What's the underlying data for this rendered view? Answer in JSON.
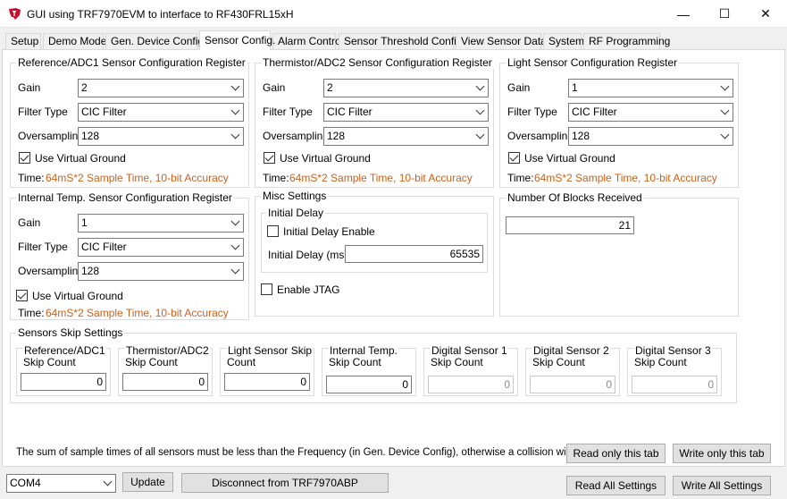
{
  "window": {
    "title": "GUI using TRF7970EVM to interface to RF430FRL15xH",
    "minimize": "—",
    "maximize": "☐",
    "close": "✕"
  },
  "tabs": [
    {
      "label": "Setup"
    },
    {
      "label": "Demo Mode"
    },
    {
      "label": "Gen. Device Config"
    },
    {
      "label": "Sensor Config."
    },
    {
      "label": "Alarm Control"
    },
    {
      "label": "Sensor Threshold Config."
    },
    {
      "label": "View Sensor Data"
    },
    {
      "label": "System"
    },
    {
      "label": "RF Programming"
    }
  ],
  "labels": {
    "gain": "Gain",
    "filter_type": "Filter Type",
    "oversampling": "Oversampling",
    "use_virtual_ground": "Use Virtual Ground",
    "time": "Time:"
  },
  "ref_adc1": {
    "title": "Reference/ADC1 Sensor Configuration Register",
    "gain": "2",
    "filter": "CIC Filter",
    "oversampling": "128",
    "time_value": "64mS*2 Sample Time, 10-bit Accuracy"
  },
  "thermistor": {
    "title": "Thermistor/ADC2 Sensor Configuration Register",
    "gain": "2",
    "filter": "CIC Filter",
    "oversampling": "128",
    "time_value": "64mS*2 Sample Time, 10-bit Accuracy"
  },
  "light": {
    "title": "Light Sensor Configuration Register",
    "gain": "1",
    "filter": "CIC Filter",
    "oversampling": "128",
    "time_value": "64mS*2 Sample Time, 10-bit Accuracy"
  },
  "internal_temp": {
    "title": "Internal Temp. Sensor Configuration Register",
    "gain": "1",
    "filter": "CIC Filter",
    "oversampling": "128",
    "time_value": "64mS*2 Sample Time, 10-bit Accuracy"
  },
  "misc": {
    "title": "Misc Settings",
    "initial_delay_title": "Initial Delay",
    "initial_delay_enable": "Initial Delay Enable",
    "initial_delay_label": "Initial Delay (ms)",
    "initial_delay_value": "65535",
    "enable_jtag": "Enable JTAG"
  },
  "blocks": {
    "title": "Number Of Blocks Received",
    "value": "21"
  },
  "skip": {
    "title": "Sensors Skip Settings",
    "items": [
      {
        "label1": "Reference/ADC1",
        "label2": "Skip Count",
        "value": "0"
      },
      {
        "label1": "Thermistor/ADC2",
        "label2": "Skip Count",
        "value": "0"
      },
      {
        "label1": "Light Sensor Skip",
        "label2": "Count",
        "value": "0"
      },
      {
        "label1": "Internal Temp.",
        "label2": "Skip Count",
        "value": "0"
      },
      {
        "label1": "Digital Sensor 1",
        "label2": "Skip Count",
        "value": "0"
      },
      {
        "label1": "Digital Sensor 2",
        "label2": "Skip Count",
        "value": "0"
      },
      {
        "label1": "Digital Sensor 3",
        "label2": "Skip Count",
        "value": "0"
      }
    ]
  },
  "footer": {
    "note": "The sum of sample times of all sensors must be less than the Frequency (in Gen. Device Config), otherwise a collision will occur.",
    "read_tab": "Read only this tab",
    "write_tab": "Write only this tab",
    "com_port": "COM4",
    "update": "Update",
    "disconnect": "Disconnect from TRF7970ABP",
    "read_all": "Read All Settings",
    "write_all": "Write All Settings"
  },
  "colors": {
    "accent_orange": "#c9621a",
    "ti_red": "#c8102e"
  }
}
